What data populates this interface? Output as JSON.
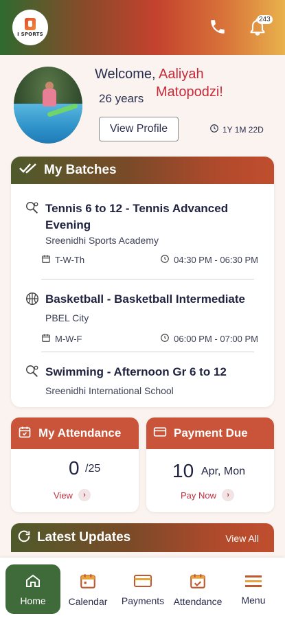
{
  "header": {
    "logo_text": "I SPORTS",
    "notification_count": "243"
  },
  "profile": {
    "welcome": "Welcome,",
    "first_name": "Aaliyah",
    "last_name": "Matopodzi!",
    "age": "26 years",
    "view_profile_label": "View Profile",
    "duration": "1Y 1M 22D"
  },
  "batches": {
    "title": "My Batches",
    "items": [
      {
        "title": "Tennis 6 to 12 - Tennis Advanced Evening",
        "location": "Sreenidhi Sports Academy",
        "days": "T-W-Th",
        "time": "04:30 PM - 06:30 PM"
      },
      {
        "title": "Basketball - Basketball Intermediate",
        "location": "PBEL City",
        "days": "M-W-F",
        "time": "06:00 PM - 07:00 PM"
      },
      {
        "title": "Swimming - Afternoon Gr 6 to 12",
        "location": "Sreenidhi International School"
      }
    ]
  },
  "attendance": {
    "title": "My Attendance",
    "value": "0",
    "total": "/25",
    "link": "View"
  },
  "payment": {
    "title": "Payment Due",
    "day": "10",
    "date": "Apr, Mon",
    "link": "Pay Now"
  },
  "updates": {
    "title": "Latest Updates",
    "view_all": "View All"
  },
  "nav": {
    "home": "Home",
    "calendar": "Calendar",
    "payments": "Payments",
    "attendance": "Attendance",
    "menu": "Menu"
  },
  "colors": {
    "accent": "#c9543a",
    "brand_green": "#3f6a3a",
    "name_red": "#c92a3a"
  }
}
